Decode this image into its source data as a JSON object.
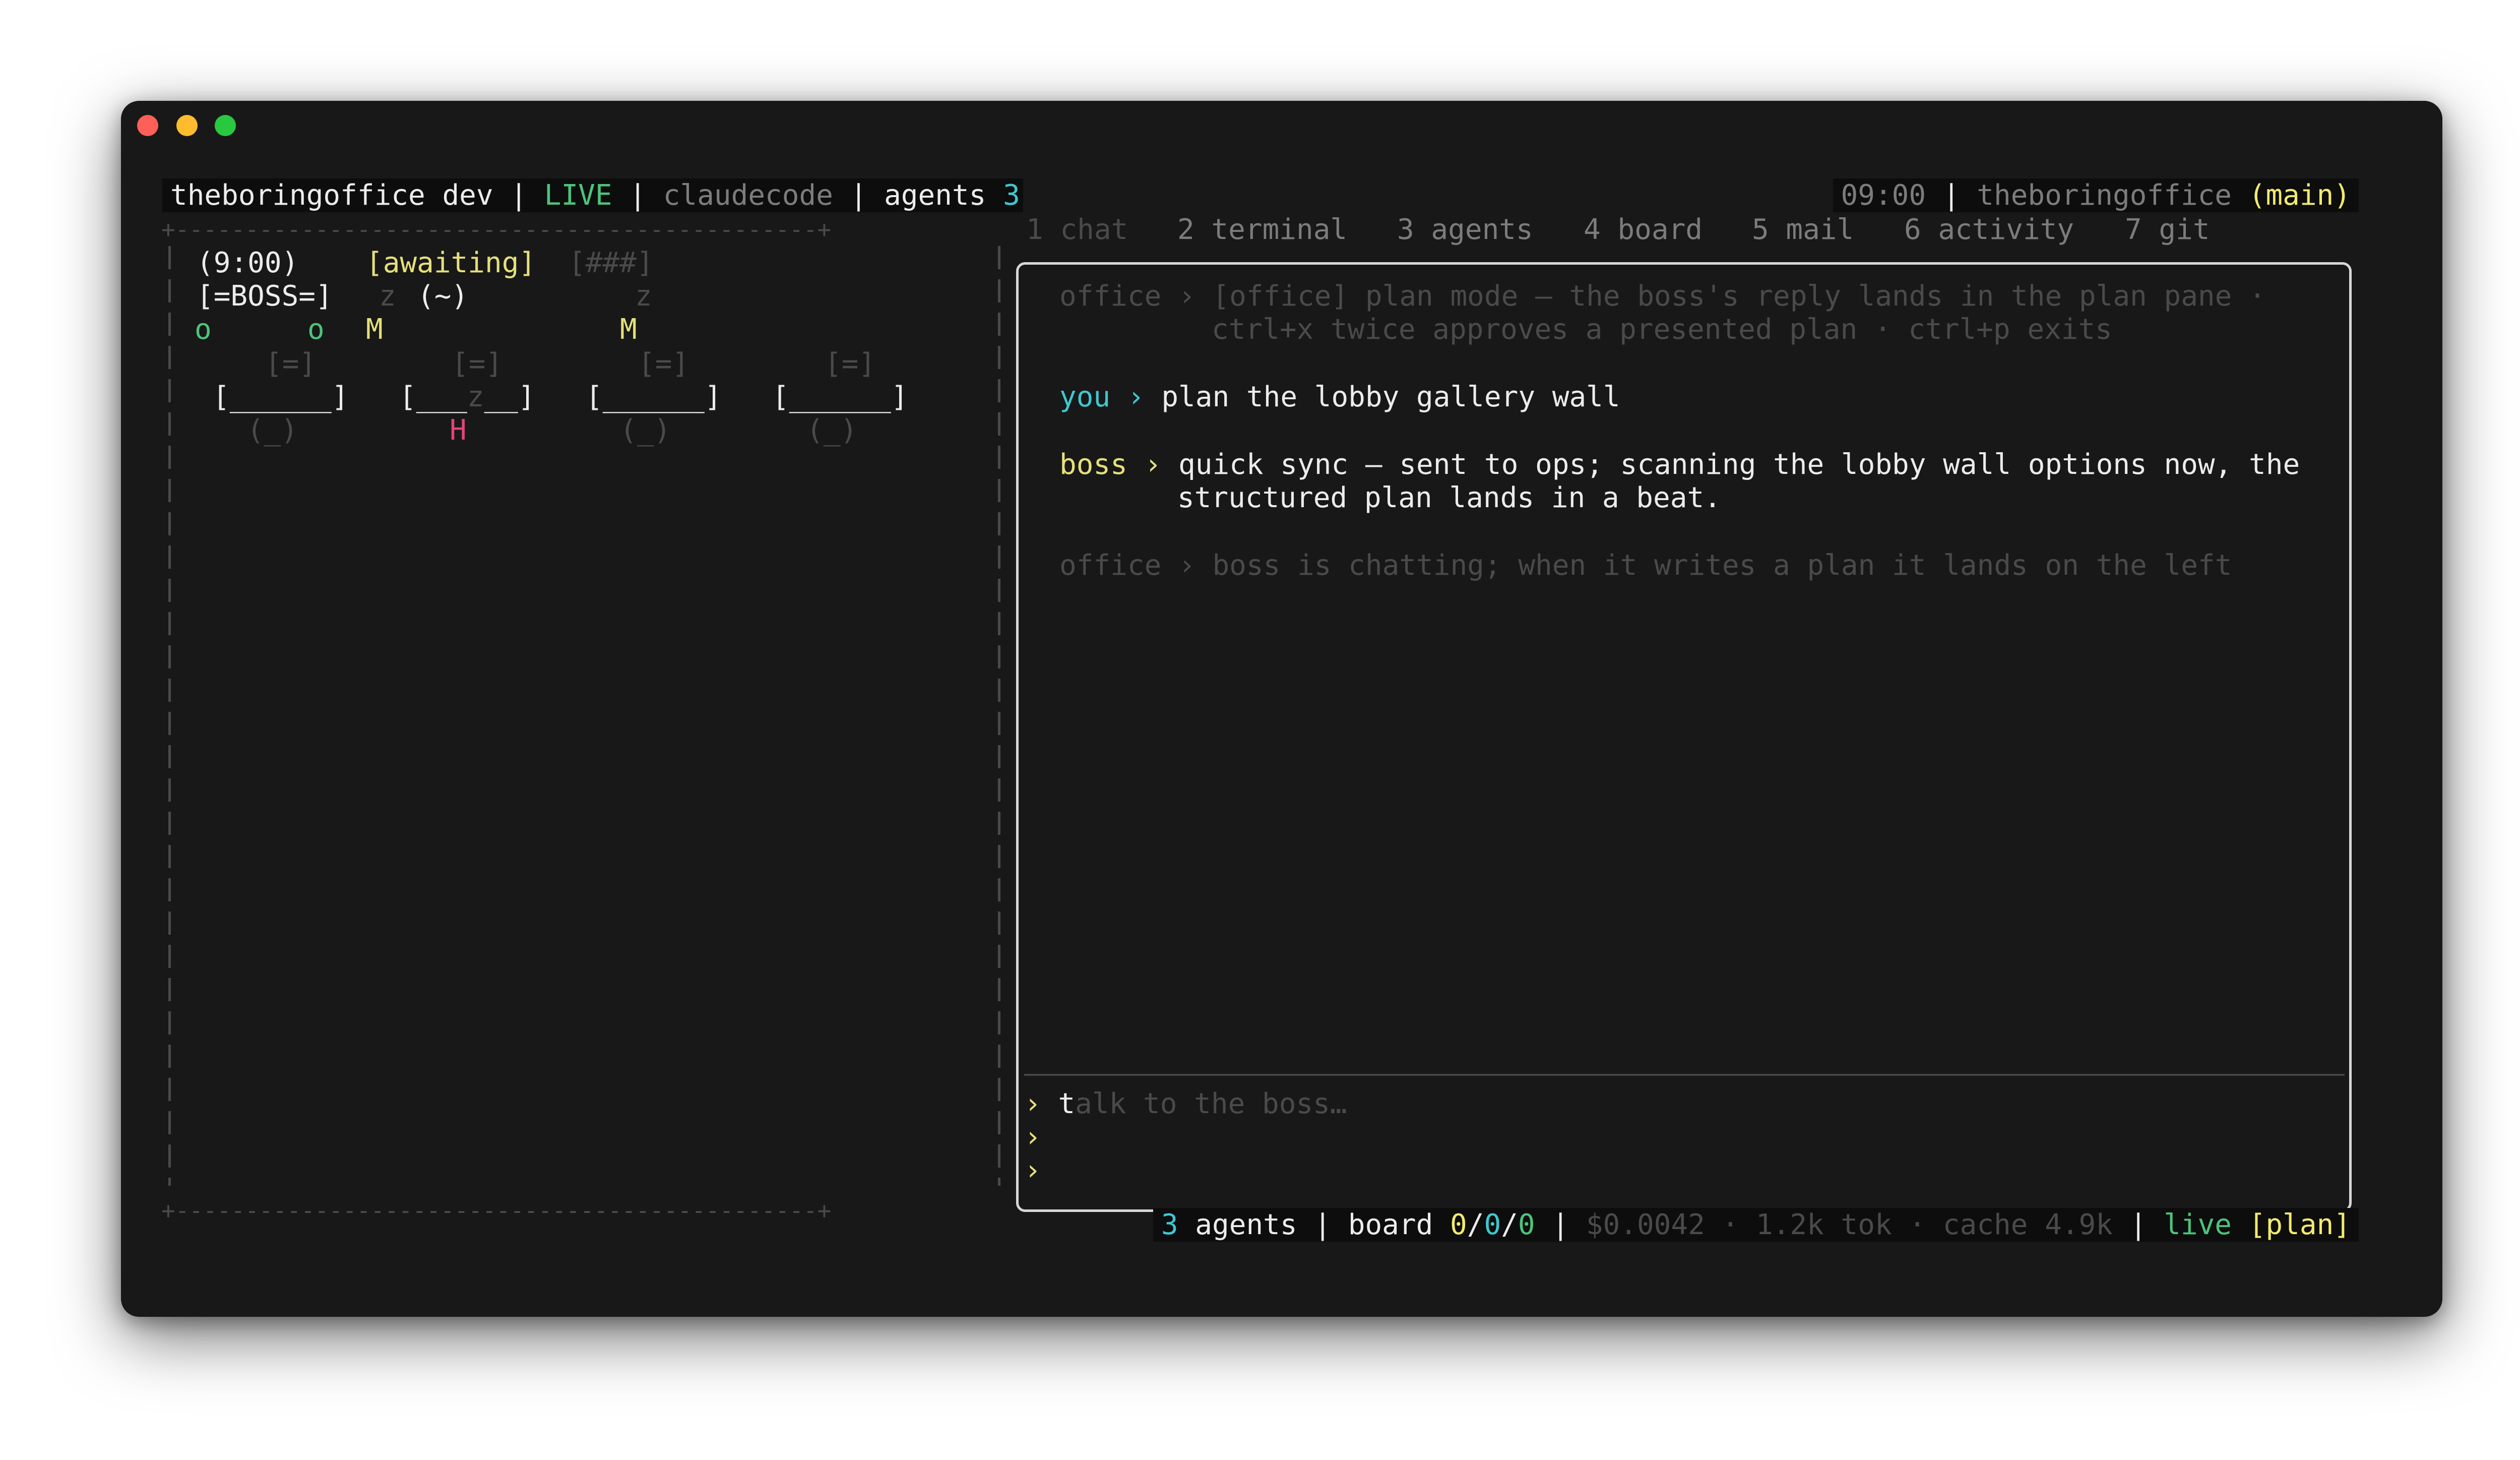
{
  "header": {
    "app_name": "theboringoffice dev",
    "sep": "|",
    "live": "LIVE",
    "backend": "claudecode",
    "agents_label": "agents",
    "agents_count": "3",
    "time": "09:00",
    "repo": "theboringoffice",
    "branch": "(main)"
  },
  "tabs": [
    {
      "label": "1 chat"
    },
    {
      "label": "2 terminal"
    },
    {
      "label": "3 agents"
    },
    {
      "label": "4 board"
    },
    {
      "label": "5 mail"
    },
    {
      "label": "6 activity"
    },
    {
      "label": "7 git"
    }
  ],
  "office": {
    "frame_top": "+----------------------------------------------+",
    "frame_bottom": "+----------------------------------------------+",
    "vline": "|",
    "clock": "(9:00)",
    "awaiting": "[awaiting]",
    "progress": "[###]",
    "boss": "[=BOSS=]",
    "z1": "z",
    "tilde": "(~)",
    "z2": "z",
    "o1": "o",
    "o2": "o",
    "m1": "M",
    "m2": "M",
    "screen": "[=]",
    "desk": "[______]",
    "desk_sleep": "[___",
    "desk_z": "z",
    "desk_sleep_end": "__]",
    "chair": "(_)",
    "h": "H"
  },
  "chat": {
    "messages": [
      {
        "speaker": "office",
        "sep": "›",
        "lines": [
          "[office] plan mode — the boss's reply lands in the plan pane ·",
          "ctrl+x twice approves a presented plan · ctrl+p exits"
        ]
      },
      {
        "speaker": "you",
        "sep": "›",
        "lines": [
          "plan the lobby gallery wall"
        ]
      },
      {
        "speaker": "boss",
        "sep": "›",
        "lines": [
          "quick sync — sent to ops; scanning the lobby wall options now, the",
          "structured plan lands in a beat."
        ]
      },
      {
        "speaker": "office",
        "sep": "›",
        "lines": [
          "boss is chatting; when it writes a plan it lands on the left"
        ]
      }
    ],
    "prompt": "›",
    "input_cursor_char": "t",
    "input_placeholder": "alk to the boss…"
  },
  "status": {
    "agents_count": "3",
    "agents_label": "agents",
    "sep": "|",
    "board_label": "board",
    "board_a": "0",
    "board_b": "0",
    "board_c": "0",
    "slash": "/",
    "cost": "$0.0042 · 1.2k tok · cache 4.9k",
    "live": "live",
    "mode": "[plan]"
  },
  "colors": {
    "background": "#181818",
    "accent_cyan": "#3ec8d0",
    "accent_green": "#4cc47c",
    "accent_yellow": "#e5e07a",
    "accent_pink": "#e0457b"
  }
}
